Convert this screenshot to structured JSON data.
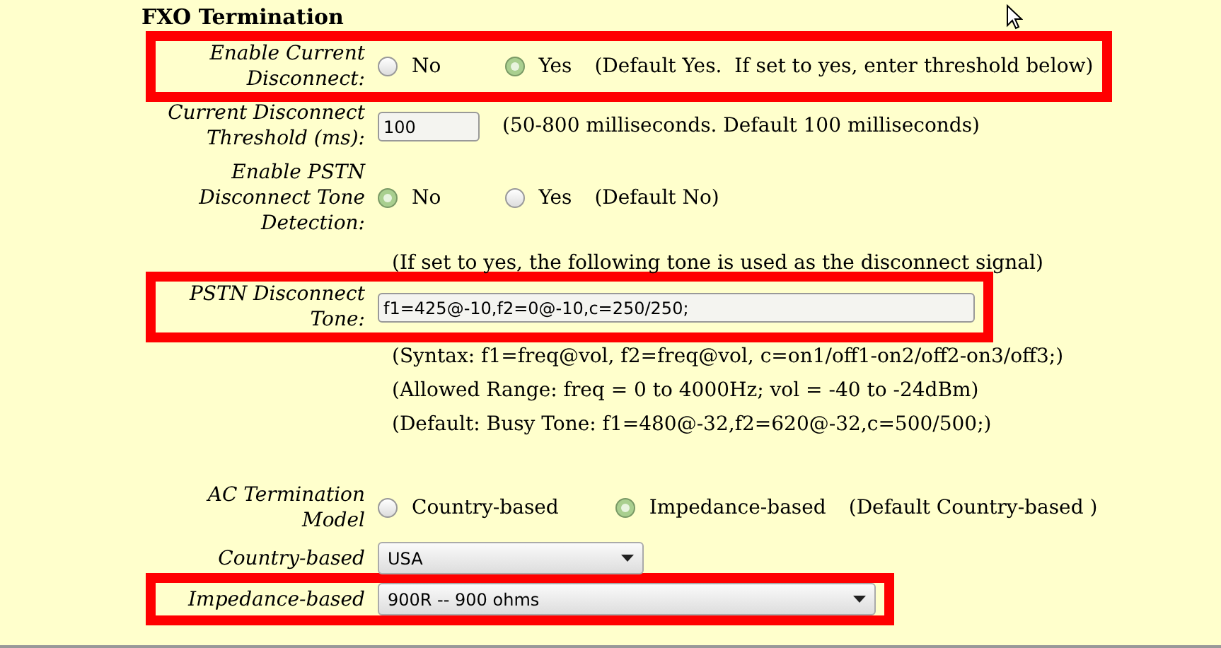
{
  "section_title": "FXO Termination",
  "rows": [
    {
      "kind": "radio",
      "label": "Enable Current Disconnect:",
      "highlighted": true,
      "options": [
        {
          "label": "No",
          "selected": false
        },
        {
          "label": "Yes",
          "selected": true
        }
      ],
      "note": "(Default Yes.  If set to yes, enter threshold below)"
    },
    {
      "kind": "input",
      "label": "Current Disconnect Threshold (ms):",
      "highlighted": false,
      "value": "100",
      "note": "(50-800 milliseconds. Default 100 milliseconds)"
    },
    {
      "kind": "radio",
      "label": "Enable PSTN Disconnect Tone Detection:",
      "highlighted": false,
      "options": [
        {
          "label": "No",
          "selected": true
        },
        {
          "label": "Yes",
          "selected": false
        }
      ],
      "note": "(Default No)"
    },
    {
      "kind": "note",
      "note": "(If set to yes, the following tone is used as the disconnect signal)"
    },
    {
      "kind": "input",
      "label": "PSTN Disconnect Tone:",
      "highlighted": true,
      "value": "f1=425@-10,f2=0@-10,c=250/250;"
    },
    {
      "kind": "note",
      "note": "(Syntax: f1=freq@vol, f2=freq@vol, c=on1/off1-on2/off2-on3/off3;)"
    },
    {
      "kind": "note",
      "note": "(Allowed Range: freq = 0 to 4000Hz; vol = -40 to -24dBm)"
    },
    {
      "kind": "note",
      "note": "(Default: Busy Tone: f1=480@-32,f2=620@-32,c=500/500;)"
    },
    {
      "kind": "radio",
      "label": "AC Termination Model",
      "highlighted": false,
      "options": [
        {
          "label": "Country-based",
          "selected": false
        },
        {
          "label": "Impedance-based",
          "selected": true
        }
      ],
      "note": "(Default Country-based )"
    },
    {
      "kind": "select",
      "label": "Country-based",
      "highlighted": false,
      "value": "USA"
    },
    {
      "kind": "select",
      "label": "Impedance-based",
      "highlighted": true,
      "value": "900R -- 900 ohms"
    }
  ]
}
